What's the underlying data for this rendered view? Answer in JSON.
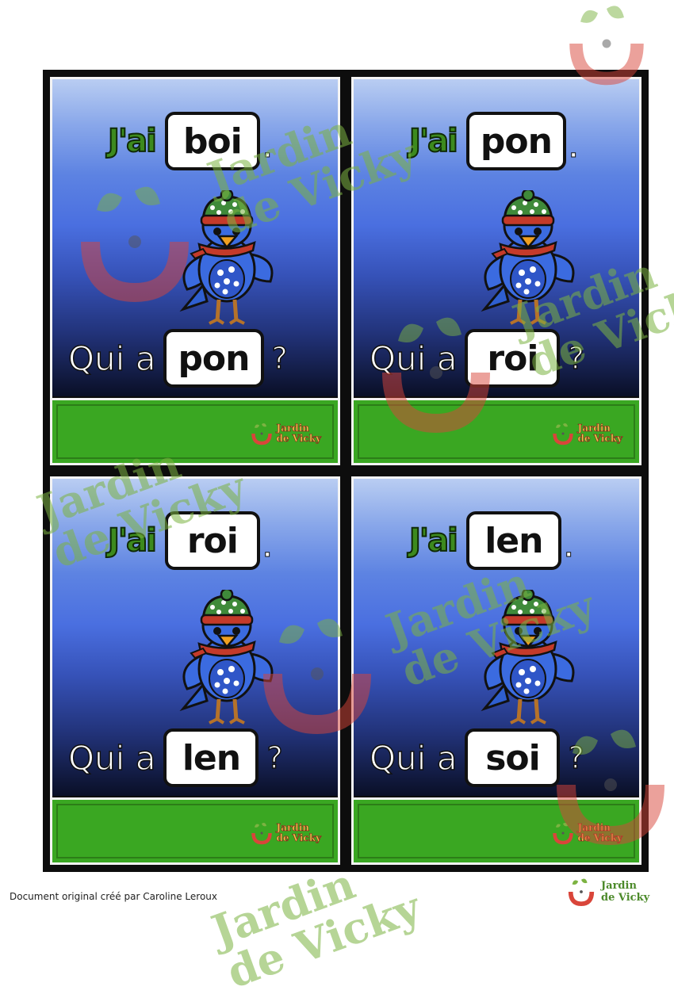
{
  "cards": [
    {
      "jai_label": "J'ai",
      "jai_word": "boi",
      "jai_period": ".",
      "qui_label": "Qui a",
      "qui_word": "pon",
      "qmark": "?"
    },
    {
      "jai_label": "J'ai",
      "jai_word": "pon",
      "jai_period": ".",
      "qui_label": "Qui a",
      "qui_word": "roi",
      "qmark": "?"
    },
    {
      "jai_label": "J'ai",
      "jai_word": "roi",
      "jai_period": ".",
      "qui_label": "Qui a",
      "qui_word": "len",
      "qmark": "?"
    },
    {
      "jai_label": "J'ai",
      "jai_word": "len",
      "jai_period": ".",
      "qui_label": "Qui a",
      "qui_word": "soi",
      "qmark": "?"
    }
  ],
  "card_logo": {
    "line1": "Jardin",
    "line2": "de Vicky"
  },
  "footer": {
    "credit": "Document original créé par Caroline Leroux",
    "logo_line1": "Jardin",
    "logo_line2": "de Vicky"
  },
  "watermark": {
    "line1": "Jardin",
    "line2": "de Vicky"
  },
  "colors": {
    "sky_top": "#b9cdf2",
    "sky_mid": "#4a6fe0",
    "sky_bottom": "#0a0f26",
    "grass": "#3aa722",
    "jai_green": "#3d8a1e",
    "watermark_green": "#7cb342"
  }
}
